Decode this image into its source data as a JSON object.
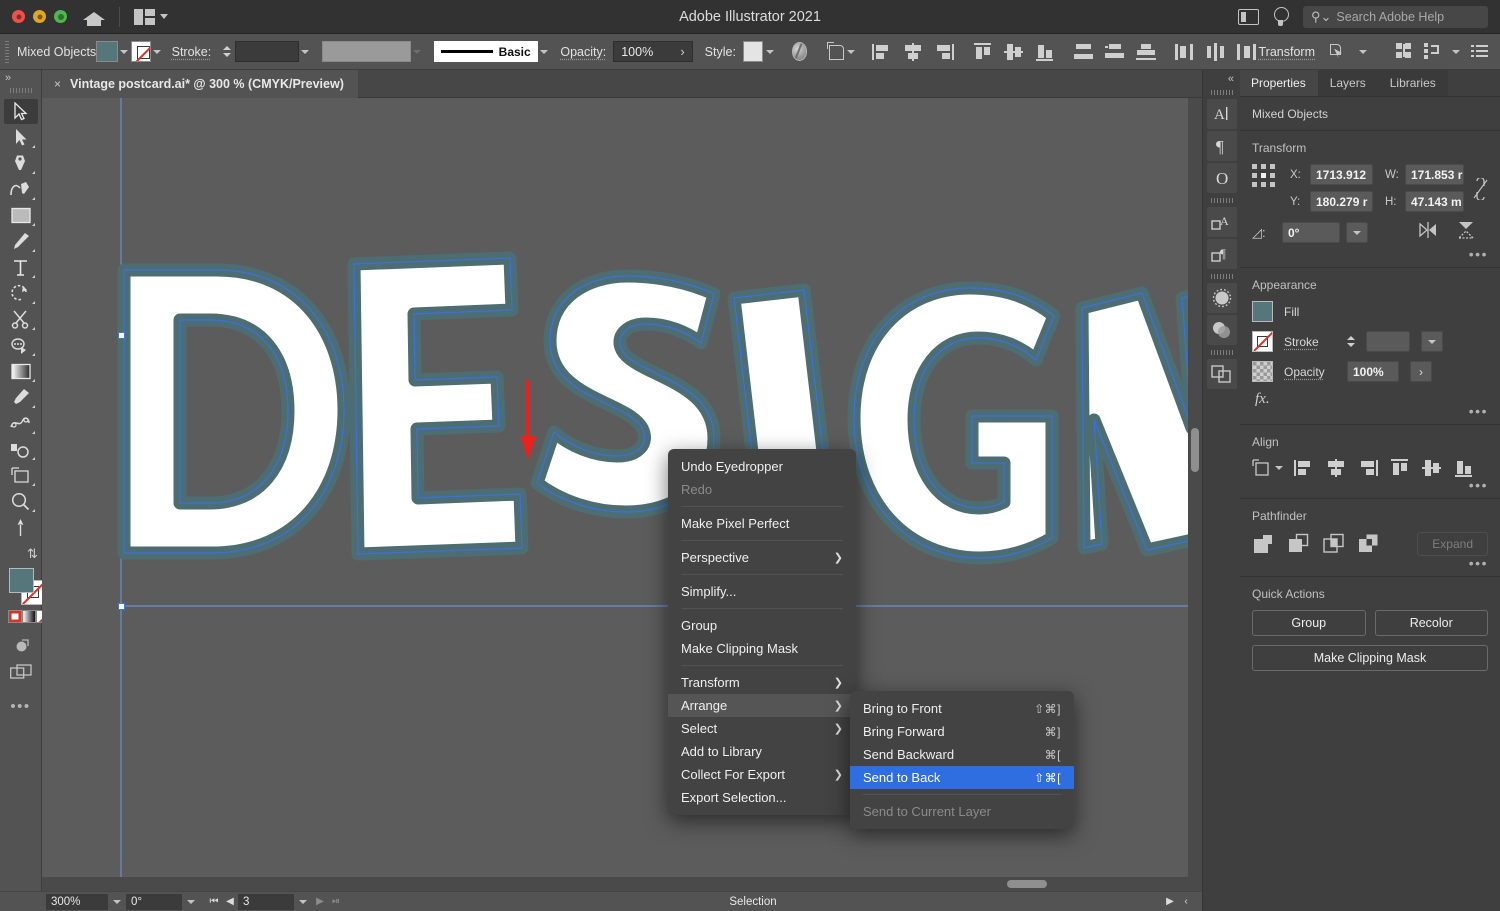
{
  "titlebar": {
    "app_title": "Adobe Illustrator 2021",
    "search_placeholder": "Search Adobe Help",
    "search_value": "",
    "icons": [
      "close-button",
      "minimize-button",
      "zoom-button",
      "home-icon",
      "arrange-documents-icon",
      "screen-mode-icon",
      "discover-icon",
      "search-icon"
    ]
  },
  "controlbar": {
    "selection_label": "Mixed Objects",
    "stroke_label": "Stroke:",
    "stroke_weight": "",
    "brush_label": "Basic",
    "opacity_label": "Opacity:",
    "opacity_value": "100%",
    "style_label": "Style:",
    "transform_label": "Transform",
    "fill_color": "#55777c",
    "stroke_color": "none"
  },
  "tools": [
    {
      "name": "selection-tool",
      "selected": true
    },
    {
      "name": "direct-selection-tool",
      "selected": false
    },
    {
      "name": "pen-tool",
      "selected": false
    },
    {
      "name": "curvature-tool",
      "selected": false
    },
    {
      "name": "rectangle-tool",
      "selected": false
    },
    {
      "name": "paintbrush-tool",
      "selected": false
    },
    {
      "name": "type-tool",
      "selected": false
    },
    {
      "name": "rotate-tool",
      "selected": false
    },
    {
      "name": "scissors-tool",
      "selected": false
    },
    {
      "name": "shape-builder-tool",
      "selected": false
    },
    {
      "name": "gradient-tool",
      "selected": false
    },
    {
      "name": "eyedropper-tool",
      "selected": false
    },
    {
      "name": "blend-tool",
      "selected": false
    },
    {
      "name": "symbol-sprayer-tool",
      "selected": false
    },
    {
      "name": "artboard-tool",
      "selected": false
    },
    {
      "name": "zoom-tool",
      "selected": false
    },
    {
      "name": "hand-tool",
      "selected": false
    }
  ],
  "document": {
    "tab_title": "Vintage postcard.ai* @ 300 % (CMYK/Preview)",
    "close_label": "×",
    "artwork_text": "DESIGN"
  },
  "statusbar": {
    "zoom_level": "300%",
    "rotation": "0°",
    "artboard_number": "3",
    "tool_status": "Selection"
  },
  "right_rail": {
    "collapse_label": "«",
    "icons": [
      "character-panel-icon",
      "paragraph-panel-icon",
      "glyphs-panel-icon",
      "character-styles-icon",
      "paragraph-styles-icon",
      "brushes-panel-icon",
      "transparency-panel-icon",
      "pathfinder-panel-icon"
    ]
  },
  "properties": {
    "tabs": [
      {
        "label": "Properties",
        "active": true
      },
      {
        "label": "Layers",
        "active": false
      },
      {
        "label": "Libraries",
        "active": false
      }
    ],
    "selection_state": "Mixed Objects",
    "transform": {
      "title": "Transform",
      "x_label": "X:",
      "x_value": "1713.912",
      "y_label": "Y:",
      "y_value": "180.279 r",
      "w_label": "W:",
      "w_value": "171.853 r",
      "h_label": "H:",
      "h_value": "47.143 m",
      "angle_label": "◿:",
      "angle_value": "0°",
      "more_label": "•••"
    },
    "appearance": {
      "title": "Appearance",
      "fill_label": "Fill",
      "fill_color": "#55777c",
      "stroke_label": "Stroke",
      "stroke_value": "",
      "opacity_label": "Opacity",
      "opacity_value": "100%",
      "fx_label": "fx.",
      "more_label": "•••"
    },
    "align": {
      "title": "Align",
      "more_label": "•••"
    },
    "pathfinder": {
      "title": "Pathfinder",
      "expand_label": "Expand",
      "more_label": "•••"
    },
    "quick_actions": {
      "title": "Quick Actions",
      "group_label": "Group",
      "recolor_label": "Recolor",
      "clipping_mask_label": "Make Clipping Mask"
    }
  },
  "context_menu": {
    "items": [
      {
        "label": "Undo Eyedropper",
        "disabled": false,
        "submenu": false,
        "divider_after": false
      },
      {
        "label": "Redo",
        "disabled": true,
        "submenu": false,
        "divider_after": true
      },
      {
        "label": "Make Pixel Perfect",
        "disabled": false,
        "submenu": false,
        "divider_after": true
      },
      {
        "label": "Perspective",
        "disabled": false,
        "submenu": true,
        "divider_after": true
      },
      {
        "label": "Simplify...",
        "disabled": false,
        "submenu": false,
        "divider_after": true
      },
      {
        "label": "Group",
        "disabled": false,
        "submenu": false,
        "divider_after": false
      },
      {
        "label": "Make Clipping Mask",
        "disabled": false,
        "submenu": false,
        "divider_after": true
      },
      {
        "label": "Transform",
        "disabled": false,
        "submenu": true,
        "divider_after": false
      },
      {
        "label": "Arrange",
        "disabled": false,
        "submenu": true,
        "divider_after": false,
        "highlighted": true
      },
      {
        "label": "Select",
        "disabled": false,
        "submenu": true,
        "divider_after": false
      },
      {
        "label": "Add to Library",
        "disabled": false,
        "submenu": false,
        "divider_after": false
      },
      {
        "label": "Collect For Export",
        "disabled": false,
        "submenu": true,
        "divider_after": false
      },
      {
        "label": "Export Selection...",
        "disabled": false,
        "submenu": false,
        "divider_after": false
      }
    ]
  },
  "arrange_submenu": {
    "items": [
      {
        "label": "Bring to Front",
        "shortcut": "⇧⌘]",
        "disabled": false,
        "active": false
      },
      {
        "label": "Bring Forward",
        "shortcut": "⌘]",
        "disabled": false,
        "active": false
      },
      {
        "label": "Send Backward",
        "shortcut": "⌘[",
        "disabled": false,
        "active": false
      },
      {
        "label": "Send to Back",
        "shortcut": "⇧⌘[",
        "disabled": false,
        "active": true
      },
      {
        "label": "Send to Current Layer",
        "shortcut": "",
        "disabled": true,
        "active": false,
        "divider_before": true
      }
    ]
  },
  "colors": {
    "accent_blue": "#2f6ee0",
    "selection_path": "#3d6fe0",
    "artwork_fill": "#ffffff",
    "artwork_outline": "#4c6e73",
    "canvas_bg": "#5c5c5c",
    "panel_bg": "#3f3f3f",
    "chrome_bg": "#535353",
    "annotation_red": "#e8231f"
  }
}
